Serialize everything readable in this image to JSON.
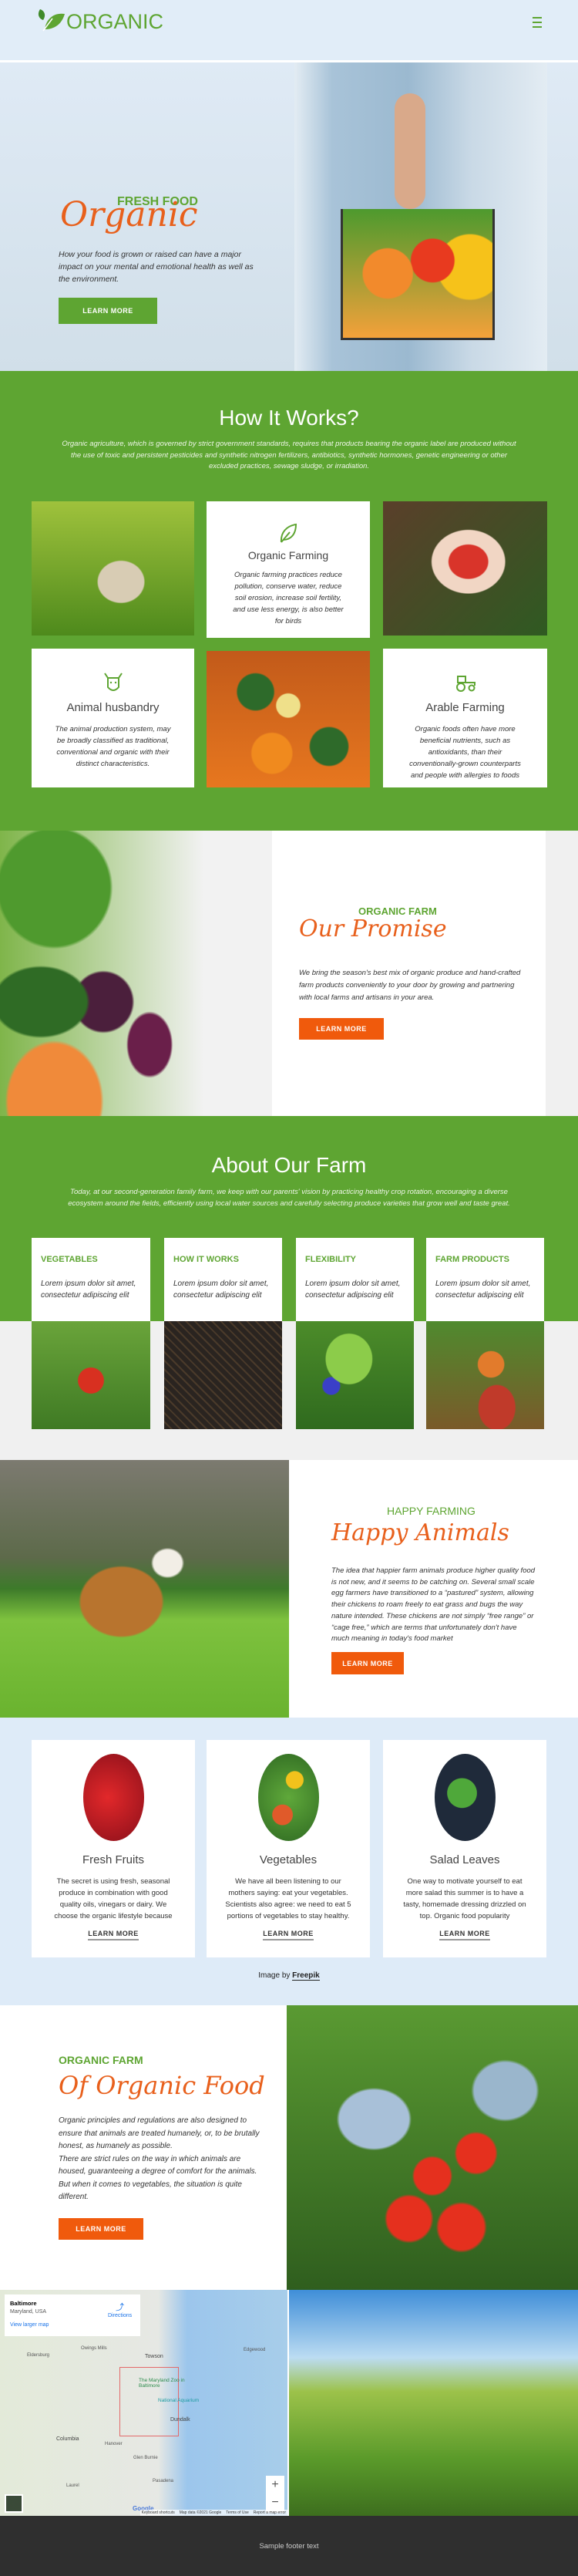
{
  "header": {
    "logo_text": "ORGANIC",
    "menu_icon": "hamburger-icon"
  },
  "hero": {
    "kicker": "FRESH FOOD",
    "script_title": "Organic",
    "text": "How your food is grown or raised can have a major impact on your mental and emotional health as well as the environment.",
    "button": "LEARN MORE"
  },
  "how": {
    "title": "How It Works?",
    "text": "Organic agriculture, which is governed by strict government standards, requires that products bearing the organic label are produced without the use of toxic and persistent pesticides and synthetic nitrogen fertilizers, antibiotics, synthetic hormones, genetic engineering or other excluded practices, sewage sludge, or irradiation.",
    "cards": [
      {
        "icon": "leaf-icon",
        "title": "Organic Farming",
        "text": "Organic farming practices reduce pollution, conserve water, reduce soil erosion, increase soil fertility, and use less energy, is also better for birds"
      },
      {
        "icon": "cow-icon",
        "title": "Animal husbandry",
        "text": "The animal production system, may be broadly classified as traditional, conventional and organic with their distinct characteristics."
      },
      {
        "icon": "tractor-icon",
        "title": "Arable Farming",
        "text": "Organic foods often have more beneficial nutrients, such as antioxidants, than their conventionally-grown counterparts and people with allergies to foods"
      }
    ]
  },
  "promise": {
    "kicker": "ORGANIC FARM",
    "script_title": "Our Promise",
    "text": "We bring the season's best mix of organic produce and hand-crafted farm products conveniently to your door by growing and partnering with local farms and artisans in your area.",
    "button": "LEARN MORE"
  },
  "about": {
    "title": "About Our Farm",
    "text": "Today, at our second-generation family farm, we keep with our parents' vision by practicing healthy crop rotation, encouraging a diverse ecosystem around the fields, efficiently using local water sources and carefully selecting produce varieties that grow well and taste great.",
    "cards": [
      {
        "title": "VEGETABLES",
        "text": "Lorem ipsum dolor sit amet, consectetur adipiscing elit"
      },
      {
        "title": "HOW IT WORKS",
        "text": "Lorem ipsum dolor sit amet, consectetur adipiscing elit"
      },
      {
        "title": "FLEXIBILITY",
        "text": "Lorem ipsum dolor sit amet, consectetur adipiscing elit"
      },
      {
        "title": "FARM PRODUCTS",
        "text": "Lorem ipsum dolor sit amet, consectetur adipiscing elit"
      }
    ]
  },
  "animals": {
    "kicker": "HAPPY FARMING",
    "script_title": "Happy Animals",
    "text": "The idea that happier farm animals produce higher quality food is not new, and it seems to be catching on. Several small scale egg farmers have transitioned to a “pastured” system, allowing their chickens to roam freely to eat grass and bugs the way nature intended. These chickens are not simply “free range” or “cage free,” which are terms that unfortunately don't have much meaning in today's food market",
    "button": "LEARN MORE"
  },
  "products": {
    "cards": [
      {
        "title": "Fresh Fruits",
        "text": "The secret is using fresh, seasonal produce in combination with good quality oils, vinegars or dairy. We choose the organic lifestyle because",
        "link": "LEARN MORE"
      },
      {
        "title": "Vegetables",
        "text": "We have all been listening to our mothers saying: eat your vegetables. Scientists also agree: we need to eat 5 portions of vegetables to stay healthy.",
        "link": "LEARN MORE"
      },
      {
        "title": "Salad Leaves",
        "text": "One way to motivate yourself to eat more salad this summer is to have a tasty, homemade dressing drizzled on top. Organic food popularity",
        "link": "LEARN MORE"
      }
    ],
    "credit_prefix": "Image by",
    "credit_link": "Freepik"
  },
  "organic_food": {
    "kicker": "ORGANIC FARM",
    "script_title": "Of Organic Food",
    "text1": "Organic principles and regulations are also designed to ensure that animals are treated humanely, or, to be brutally honest, as humanely as possible.",
    "text2": "There are strict rules on the way in which animals are housed, guaranteeing a degree of comfort for the animals. But when it comes to vegetables, the situation is quite different.",
    "button": "LEARN MORE"
  },
  "map": {
    "place": "Baltimore",
    "region": "Maryland, USA",
    "directions": "Directions",
    "larger": "View larger map",
    "labels": [
      "Towson",
      "Columbia",
      "Dundalk",
      "Owings Mills",
      "Eldersburg",
      "Glen Burnie",
      "Pasadena",
      "Hanover",
      "Laurel",
      "Edgewood",
      "The Maryland Zoo in Baltimore",
      "National Aquarium"
    ],
    "attribution": [
      "Keyboard shortcuts",
      "Map data ©2021 Google",
      "Terms of Use",
      "Report a map error"
    ],
    "google": "Google"
  },
  "footer": {
    "text": "Sample footer text"
  },
  "colors": {
    "green": "#5ea532",
    "orange": "#f05a0c",
    "light_blue": "#deebf8",
    "footer": "#2f2f2f"
  }
}
